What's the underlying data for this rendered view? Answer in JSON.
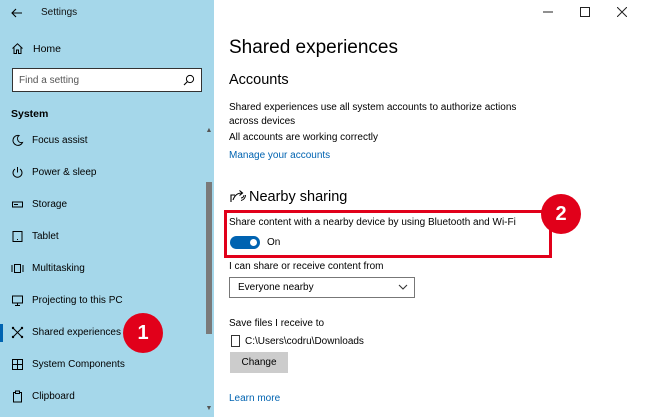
{
  "window": {
    "title": "Settings",
    "controls": [
      "minimize",
      "maximize",
      "close"
    ]
  },
  "sidebar": {
    "home_label": "Home",
    "search_placeholder": "Find a setting",
    "section_label": "System",
    "items": [
      {
        "label": "Focus assist",
        "icon": "moon-icon"
      },
      {
        "label": "Power & sleep",
        "icon": "power-icon"
      },
      {
        "label": "Storage",
        "icon": "storage-icon"
      },
      {
        "label": "Tablet",
        "icon": "tablet-icon"
      },
      {
        "label": "Multitasking",
        "icon": "multitasking-icon"
      },
      {
        "label": "Projecting to this PC",
        "icon": "projecting-icon"
      },
      {
        "label": "Shared experiences",
        "icon": "shared-experiences-icon",
        "active": true
      },
      {
        "label": "System Components",
        "icon": "components-icon"
      },
      {
        "label": "Clipboard",
        "icon": "clipboard-icon"
      }
    ],
    "badge": "1"
  },
  "main": {
    "title": "Shared experiences",
    "accounts_heading": "Accounts",
    "accounts_desc": "Shared experiences use all system accounts to authorize actions across devices",
    "accounts_status": "All accounts are working correctly",
    "manage_link": "Manage your accounts",
    "nearby_heading": "Nearby sharing",
    "nearby_desc": "Share content with a nearby device by using Bluetooth and Wi-Fi",
    "toggle_label": "On",
    "toggle_state": true,
    "badge": "2",
    "share_receive_label": "I can share or receive content from",
    "share_receive_value": "Everyone nearby",
    "save_files_label": "Save files I receive to",
    "save_path": "C:\\Users\\codru\\Downloads",
    "change_button": "Change",
    "learn_more": "Learn more"
  },
  "colors": {
    "sidebar_bg": "#a5d7ea",
    "accent": "#0063b1",
    "highlight_red": "#e1001a"
  }
}
